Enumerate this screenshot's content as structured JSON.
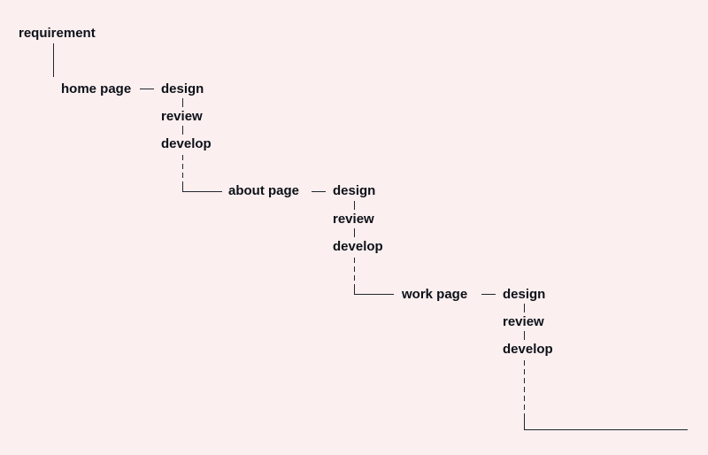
{
  "root": "requirement",
  "pages": [
    {
      "name": "home page",
      "steps": [
        "design",
        "review",
        "develop"
      ]
    },
    {
      "name": "about page",
      "steps": [
        "design",
        "review",
        "develop"
      ]
    },
    {
      "name": "work page",
      "steps": [
        "design",
        "review",
        "develop"
      ]
    }
  ]
}
